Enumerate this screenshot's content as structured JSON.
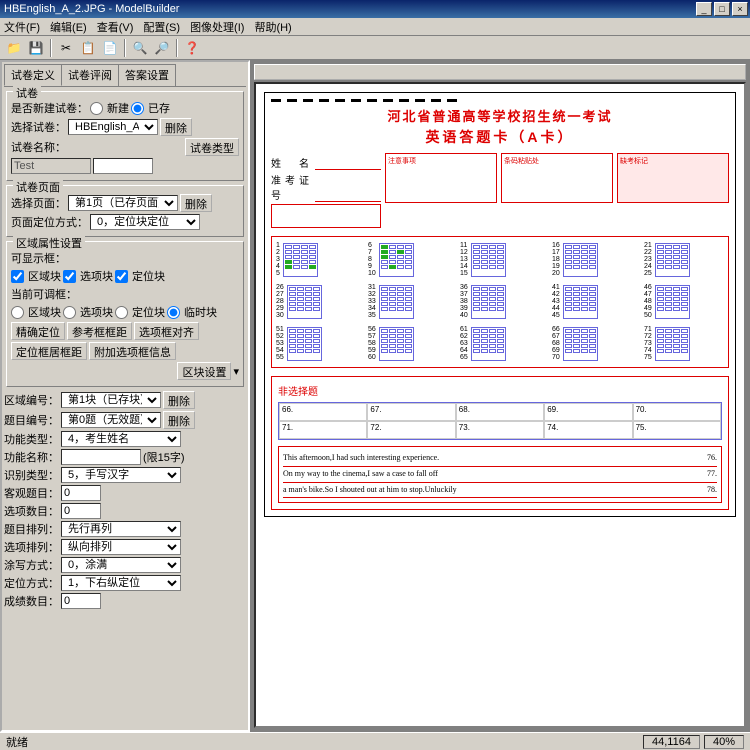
{
  "window": {
    "title": "HBEnglish_A_2.JPG - ModelBuilder",
    "min": "_",
    "max": "□",
    "close": "×"
  },
  "menu": {
    "file": "文件(F)",
    "edit": "编辑(E)",
    "view": "查看(V)",
    "config": "配置(S)",
    "image": "图像处理(I)",
    "help": "帮助(H)"
  },
  "toolbar": {
    "icons": [
      "📁",
      "💾",
      "✂",
      "📋",
      "📄",
      "🔍",
      "🔎",
      "❓"
    ]
  },
  "tabs": {
    "t1": "试卷定义",
    "t2": "试卷评阅",
    "t3": "答案设置"
  },
  "g_paper": {
    "title": "试卷",
    "new_label": "是否新建试卷：",
    "r_new": "新建",
    "r_exist": "已存",
    "select_label": "选择试卷：",
    "select_value": "HBEnglish_A",
    "browse": "删除",
    "name_label": "试卷名称：",
    "name_value": "",
    "test_label": "Test",
    "type_btn": "试卷类型"
  },
  "g_page": {
    "title": "试卷页面",
    "page_label": "选择页面：",
    "page_value": "第1页（已存页面）",
    "del": "删除",
    "locate_label": "页面定位方式：",
    "locate_value": "0，定位块定位"
  },
  "g_region": {
    "title": "区域属性设置",
    "show_label": "可显示框：",
    "c1": "区域块",
    "c2": "选项块",
    "c3": "定位块",
    "adj_label": "当前可调框：",
    "r1": "区域块",
    "r2": "选项块",
    "r3": "定位块",
    "r4": "临时块",
    "b1": "精确定位",
    "b2": "参考框框距",
    "b3": "选项框对齐",
    "b4": "定位框居框距",
    "b5": "附加选项框信息",
    "set_btn": "区块设置"
  },
  "fields": {
    "f1_l": "区域编号：",
    "f1_v": "第1块（已存块）",
    "f1_b": "删除",
    "f2_l": "题目编号：",
    "f2_v": "第0题（无效题）",
    "f2_b": "删除",
    "f3_l": "功能类型：",
    "f3_v": "4，考生姓名",
    "f4_l": "功能名称：",
    "f4_v": "",
    "f4_h": "(限15字)",
    "f5_l": "识别类型：",
    "f5_v": "5，手写汉字",
    "f6_l": "客观题目：",
    "f6_v": "0",
    "f7_l": "选项数目：",
    "f7_v": "0",
    "f8_l": "题目排列：",
    "f8_v": "先行再列",
    "f9_l": "选项排列：",
    "f9_v": "纵向排列",
    "f10_l": "涂写方式：",
    "f10_v": "0，涂满",
    "f11_l": "定位方式：",
    "f11_v": "1，下右纵定位",
    "f12_l": "成绩数目：",
    "f12_v": "0"
  },
  "sheet": {
    "title1": "河北省普通高等学校招生统一考试",
    "title2": "英语答题卡（A卡）",
    "name_l": "姓　名",
    "id_l": "准考证号",
    "box1_t": "注意事项",
    "box2_t": "条码粘贴处",
    "box3_t": "缺考标记",
    "essay_title": "非选择题",
    "essay_nums": [
      "66.",
      "67.",
      "68.",
      "69.",
      "70.",
      "71.",
      "72.",
      "73.",
      "74.",
      "75."
    ],
    "essay_lines": [
      "This afternoon,I had such interesting experience.",
      "On my way to the cinema,I saw a case to fall off",
      "a man's bike.So I shouted out at him to stop.Unluckily"
    ],
    "essay_line_nums": [
      "76.",
      "77.",
      "78."
    ]
  },
  "status": {
    "ready": "就绪",
    "coords": "44,1164",
    "zoom": "40%"
  }
}
